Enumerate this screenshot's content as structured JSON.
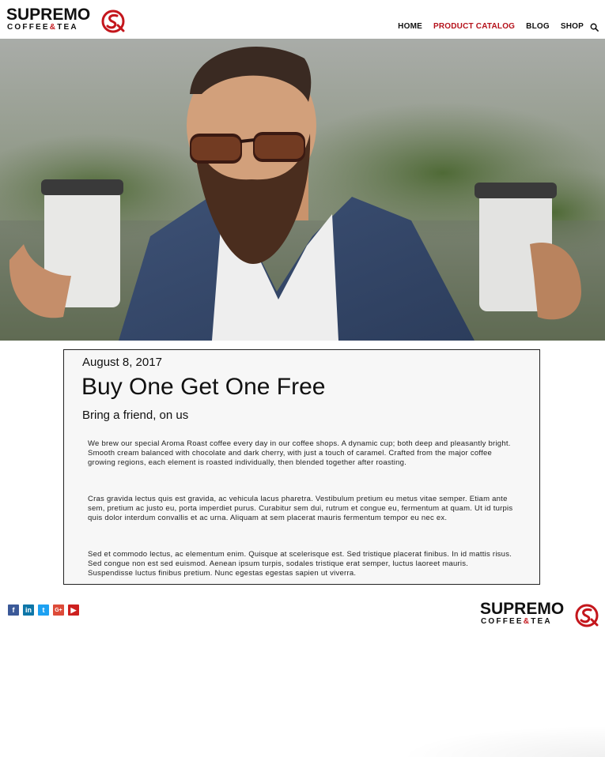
{
  "brand": {
    "name": "SUPREMO",
    "sub_before": "COFFEE",
    "sub_amp": "&",
    "sub_after": "TEA",
    "accent": "#c4161c"
  },
  "nav": {
    "items": [
      {
        "label": "HOME",
        "active": false
      },
      {
        "label": "PRODUCT CATALOG",
        "active": true
      },
      {
        "label": "BLOG",
        "active": false
      },
      {
        "label": "SHOP",
        "active": false
      }
    ],
    "search_icon": "search-icon"
  },
  "hero": {
    "icon": "photo-man-with-coffee-cups"
  },
  "article": {
    "date": "August 8, 2017",
    "title": "Buy One Get One Free",
    "subtitle": "Bring a friend, on us",
    "paragraphs": [
      "We brew our special Aroma Roast coffee every day in our coffee shops.  A dynamic cup; both deep and pleasantly bright. Smooth cream balanced with chocolate and dark cherry, with just a touch of caramel. Crafted from the major coffee growing regions, each element is roasted individually, then blended together after roasting.",
      "Cras gravida lectus quis est gravida, ac vehicula lacus pharetra. Vestibulum pretium eu metus vitae semper. Etiam ante sem, pretium ac justo eu, porta imperdiet purus. Curabitur sem dui, rutrum et congue eu, fermentum at quam. Ut id turpis quis dolor interdum convallis et ac urna. Aliquam at sem placerat mauris fermentum tempor eu nec ex.",
      "Sed et commodo lectus, ac elementum enim. Quisque at scelerisque est. Sed tristique placerat finibus. In id mattis risus. Sed congue non est sed euismod. Aenean ipsum turpis, sodales tristique erat semper, luctus laoreet mauris. Suspendisse luctus finibus pretium. Nunc egestas egestas sapien ut viverra."
    ]
  },
  "footer": {
    "social": [
      {
        "name": "facebook-icon",
        "glyph": "f"
      },
      {
        "name": "linkedin-icon",
        "glyph": "in"
      },
      {
        "name": "twitter-icon",
        "glyph": "t"
      },
      {
        "name": "google-plus-icon",
        "glyph": "G+"
      },
      {
        "name": "youtube-icon",
        "glyph": "▶"
      }
    ]
  }
}
